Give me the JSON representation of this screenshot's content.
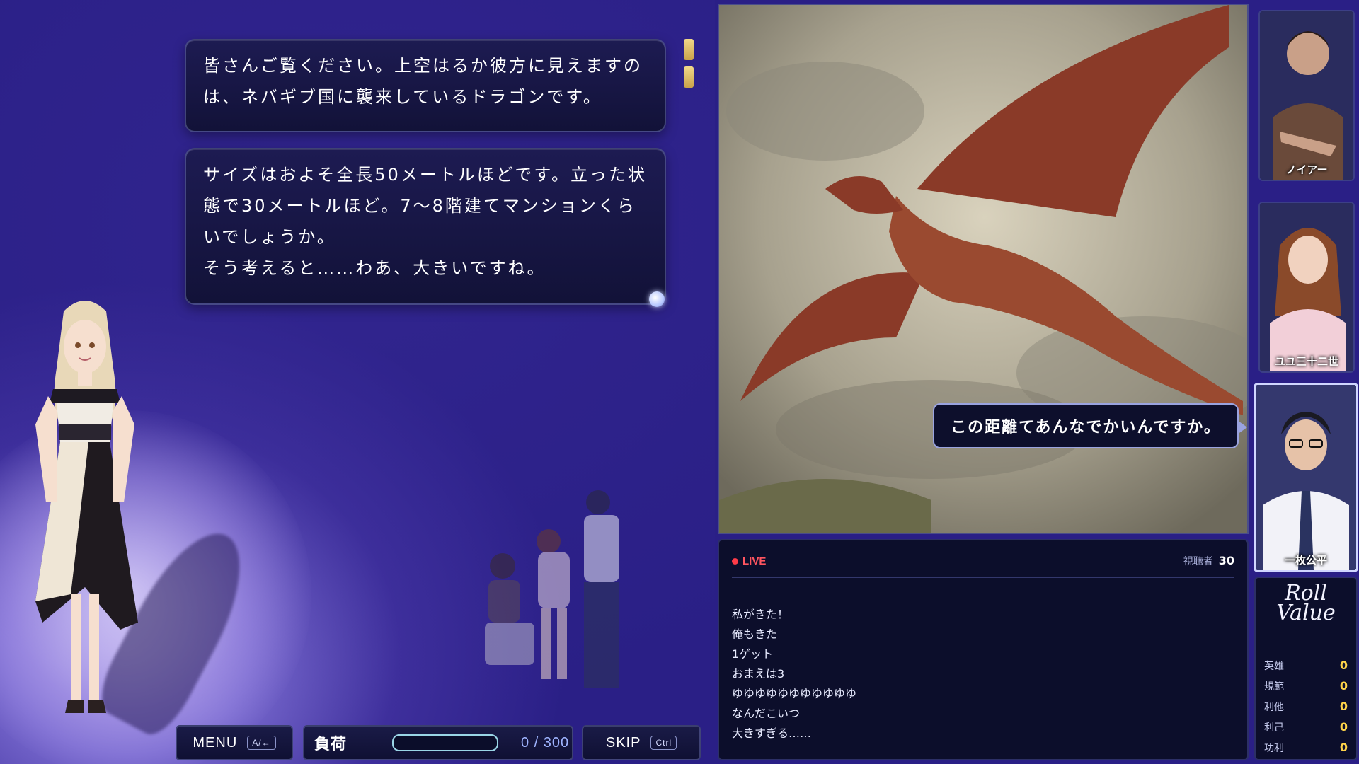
{
  "dialogue": {
    "box1": "皆さんご覧ください。上空はるか彼方に見えますの\nは、ネバギブ国に襲来しているドラゴンです。",
    "box2": "サイズはおよそ全長50メートルほどです。立った状\n態で30メートルほど。7〜8階建てマンションくら\nいでしょうか。\nそう考えると……わあ、大きいですね。"
  },
  "speech_bubble": "この距離てあんなでかいんですか。",
  "bottom_bar": {
    "menu_label": "MENU",
    "menu_key": "A/←",
    "load_label": "負荷",
    "load_value": "0 / 300",
    "load_fraction": 0,
    "skip_label": "SKIP",
    "skip_key": "Ctrl"
  },
  "live": {
    "tag": "LIVE",
    "viewers_label": "視聴者",
    "viewers_count": "30",
    "messages": [
      "私がきた！",
      "俺もきた",
      "1ゲット",
      "おまえは3",
      "ゆゆゆゆゆゆゆゆゆゆゆ",
      "なんだこいつ",
      "大きすぎる……"
    ]
  },
  "portraits": [
    {
      "name": "ノイアー"
    },
    {
      "name": "ユユ三十二世"
    },
    {
      "name": "一枚公平"
    }
  ],
  "values": {
    "logo_line1": "Roll",
    "logo_line2": "Value",
    "rows": [
      {
        "label": "英雄",
        "value": "0"
      },
      {
        "label": "規範",
        "value": "0"
      },
      {
        "label": "利他",
        "value": "0"
      },
      {
        "label": "利己",
        "value": "0"
      },
      {
        "label": "功利",
        "value": "0"
      }
    ]
  },
  "colors": {
    "accent": "#ffd44a",
    "live": "#ff3b48",
    "bar": "#66c6e0"
  }
}
